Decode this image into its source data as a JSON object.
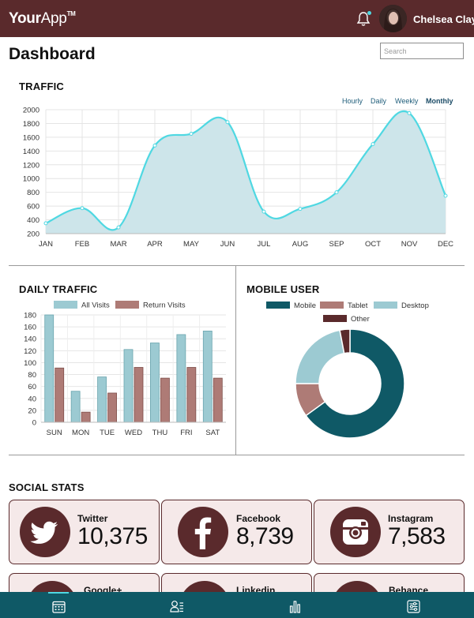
{
  "app": {
    "logo_bold": "Your",
    "logo_light": "App",
    "logo_tm": "TM",
    "user_name": "Chelsea Clay"
  },
  "colors": {
    "topbar": "#5a2a2c",
    "accent": "#4fd8e2",
    "bottom_nav": "#0f5966",
    "card_bg": "#f5e9e9"
  },
  "icons": {
    "notifications": "bell-icon",
    "avatar": "user-avatar",
    "nav": [
      "calendar-icon",
      "contacts-icon",
      "bar-chart-icon",
      "settings-sliders-icon"
    ]
  },
  "header": {
    "title": "Dashboard",
    "search_placeholder": "Search"
  },
  "traffic": {
    "title": "TRAFFIC",
    "ranges": [
      "Hourly",
      "Daily",
      "Weekly",
      "Monthly"
    ],
    "active_range": "Monthly"
  },
  "daily_traffic": {
    "title": "DAILY TRAFFIC"
  },
  "mobile_users": {
    "title": "MOBILE USER"
  },
  "social": {
    "title": "SOCIAL STATS",
    "cards": [
      {
        "name": "Twitter",
        "count": "10,375",
        "icon": "twitter-icon"
      },
      {
        "name": "Facebook",
        "count": "8,739",
        "icon": "facebook-icon"
      },
      {
        "name": "Instagram",
        "count": "7,583",
        "icon": "instagram-icon"
      },
      {
        "name": "Google+",
        "icon": "google-plus-icon"
      },
      {
        "name": "Linkedin",
        "icon": "linkedin-icon"
      },
      {
        "name": "Behance",
        "icon": "behance-icon"
      }
    ]
  },
  "chart_data": [
    {
      "type": "area",
      "title": "TRAFFIC",
      "categories": [
        "JAN",
        "FEB",
        "MAR",
        "APR",
        "MAY",
        "JUN",
        "JUL",
        "AUG",
        "SEP",
        "OCT",
        "NOV",
        "DEC"
      ],
      "values": [
        350,
        570,
        290,
        1480,
        1650,
        1820,
        520,
        560,
        800,
        1500,
        1950,
        750
      ],
      "y_ticks": [
        200,
        400,
        600,
        800,
        1000,
        1200,
        1400,
        1600,
        1800,
        2000
      ],
      "ylim": [
        200,
        2000
      ],
      "grid": true,
      "line_color": "#4fd8e2",
      "fill_color": "#cde5ea"
    },
    {
      "type": "bar",
      "title": "DAILY TRAFFIC",
      "categories": [
        "SUN",
        "MON",
        "TUE",
        "WED",
        "THU",
        "FRI",
        "SAT"
      ],
      "series": [
        {
          "name": "All Visits",
          "values": [
            180,
            52,
            76,
            122,
            133,
            147,
            153
          ],
          "color": "#9ccad2"
        },
        {
          "name": "Return Visits",
          "values": [
            91,
            17,
            49,
            92,
            74,
            92,
            74
          ],
          "color": "#ae7b76"
        }
      ],
      "y_ticks": [
        0,
        20,
        40,
        60,
        80,
        100,
        120,
        140,
        160,
        180
      ],
      "ylim": [
        0,
        180
      ],
      "legend": "top",
      "grid": true
    },
    {
      "type": "pie",
      "title": "MOBILE USER",
      "donut": true,
      "labels": [
        "Mobile",
        "Tablet",
        "Desktop",
        "Other"
      ],
      "values": [
        65,
        10,
        22,
        3
      ],
      "colors": [
        "#0f5966",
        "#ae7b76",
        "#9ccad2",
        "#5a2a2c"
      ],
      "legend": "top"
    }
  ]
}
